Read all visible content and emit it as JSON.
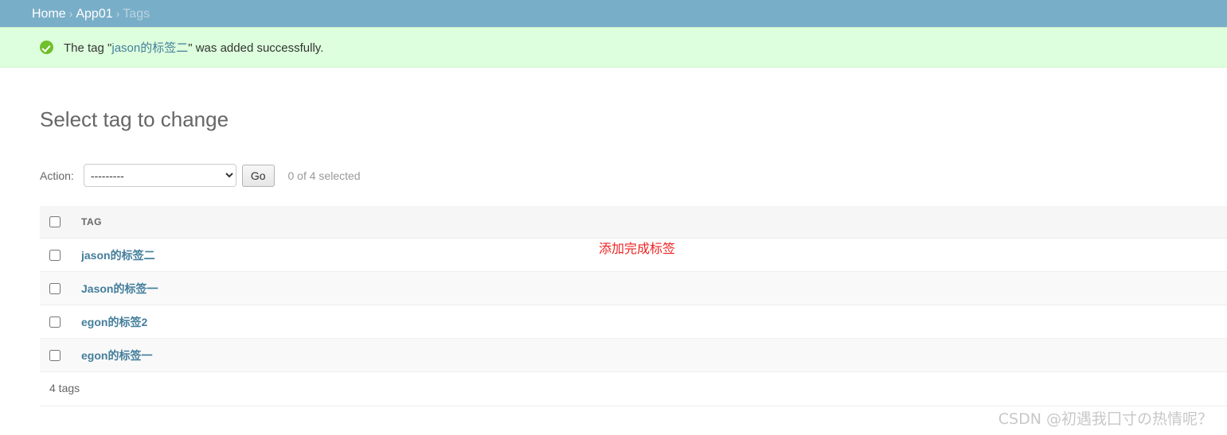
{
  "breadcrumb": {
    "items": [
      {
        "label": "Home",
        "current": false
      },
      {
        "label": "App01",
        "current": false
      },
      {
        "label": "Tags",
        "current": true
      }
    ],
    "separator": "›",
    "bar_color": "#79aec8"
  },
  "message": {
    "icon": "success-check-icon",
    "icon_color": "#70bf2b",
    "background": "#ddffdd",
    "prefix": "The tag \"",
    "tag_name": "jason的标签二",
    "suffix": "\" was added successfully."
  },
  "page": {
    "title": "Select tag to change"
  },
  "actions": {
    "label": "Action:",
    "selected_option": "---------",
    "options": [
      "---------"
    ],
    "go_label": "Go",
    "counter": "0 of 4 selected"
  },
  "table": {
    "select_all_name": "select-all-checkbox",
    "columns": [
      "TAG"
    ],
    "rows": [
      {
        "tag": "jason的标签二"
      },
      {
        "tag": "Jason的标签一"
      },
      {
        "tag": "egon的标签2"
      },
      {
        "tag": "egon的标签一"
      }
    ]
  },
  "paginator": {
    "count_label": "4 tags"
  },
  "annotation": {
    "text": "添加完成标签",
    "color": "#ee2222"
  },
  "watermark": {
    "text": "CSDN @初遇我囗寸の热情呢？"
  }
}
